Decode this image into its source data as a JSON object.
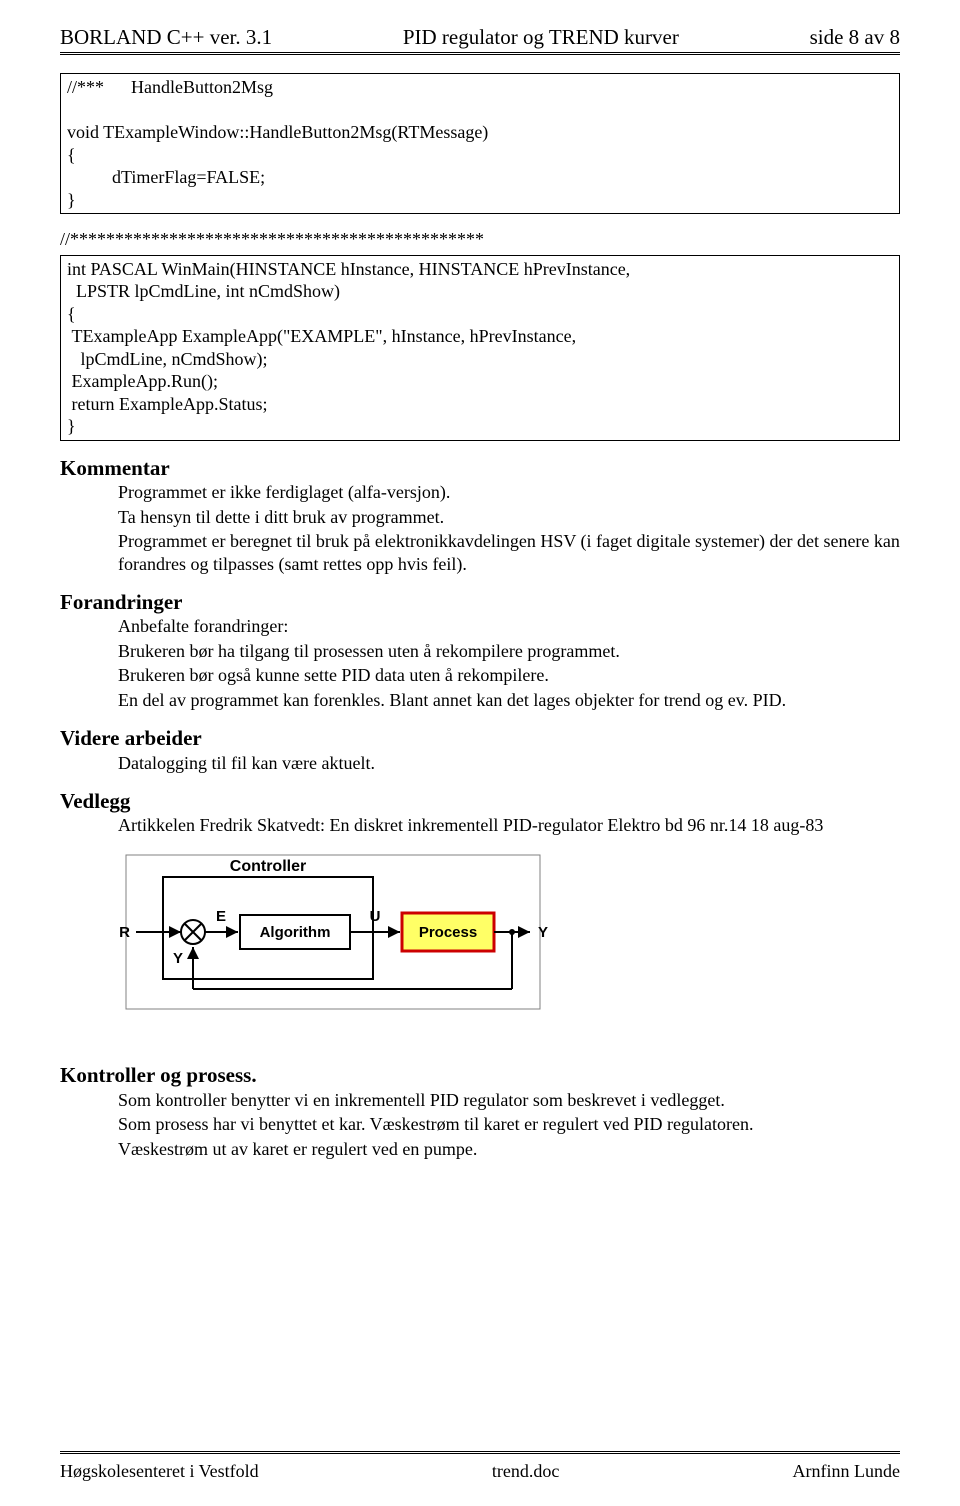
{
  "header": {
    "left": "BORLAND C++ ver. 3.1",
    "center": "PID regulator og TREND kurver",
    "right": "side 8 av 8"
  },
  "codebox1": "//***      HandleButton2Msg\n\nvoid TExampleWindow::HandleButton2Msg(RTMessage)\n{\n          dTimerFlag=FALSE;\n}",
  "codeline": "//**********************************************",
  "codebox2": "int PASCAL WinMain(HINSTANCE hInstance, HINSTANCE hPrevInstance,\n  LPSTR lpCmdLine, int nCmdShow)\n{\n TExampleApp ExampleApp(\"EXAMPLE\", hInstance, hPrevInstance,\n   lpCmdLine, nCmdShow);\n ExampleApp.Run();\n return ExampleApp.Status;\n}",
  "sections": {
    "kommentar": {
      "title": "Kommentar",
      "p1": "Programmet er ikke ferdiglaget (alfa-versjon).",
      "p2": "Ta hensyn til dette i ditt bruk av programmet.",
      "p3": "Programmet er beregnet til bruk på elektronikkavdelingen HSV (i faget digitale systemer) der det senere kan forandres og tilpasses (samt rettes opp hvis feil)."
    },
    "forandringer": {
      "title": "Forandringer",
      "p1": "Anbefalte forandringer:",
      "p2": "Brukeren bør ha tilgang til prosessen uten å rekompilere programmet.",
      "p3": "Brukeren bør også kunne sette PID data uten å rekompilere.",
      "p4": "En del av programmet kan forenkles. Blant annet kan det lages objekter for trend og ev. PID."
    },
    "videre": {
      "title": "Videre arbeider",
      "p1": "Datalogging til fil kan være aktuelt."
    },
    "vedlegg": {
      "title": "Vedlegg",
      "p1": "Artikkelen  Fredrik Skatvedt:  En diskret inkrementell PID-regulator   Elektro bd 96 nr.14 18 aug-83"
    },
    "kontroller": {
      "title": "Kontroller og prosess.",
      "p1": "Som kontroller benytter vi en inkrementell PID regulator som beskrevet i vedlegget.",
      "p2": "Som prosess har vi benyttet et kar. Væskestrøm til karet er regulert ved PID regulatoren.",
      "p3": "Væskestrøm ut av karet er regulert ved en pumpe."
    }
  },
  "diagram": {
    "title": "Controller",
    "algorithm": "Algorithm",
    "process": "Process",
    "R": "R",
    "E": "E",
    "U": "U",
    "Y": "Y",
    "Yfb": "Y"
  },
  "footer": {
    "left": "Høgskolesenteret i Vestfold",
    "center": "trend.doc",
    "right": "Arnfinn Lunde"
  }
}
